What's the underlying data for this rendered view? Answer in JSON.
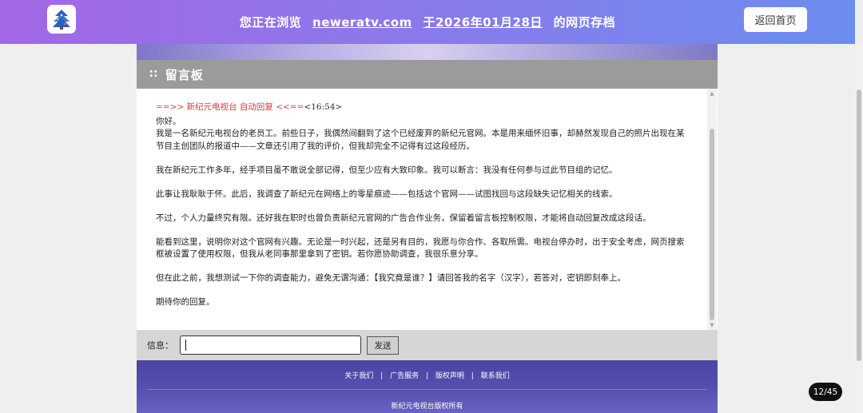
{
  "archive_banner": {
    "prefix": "您正在浏览",
    "domain": "neweratv.com",
    "date_text": "于2026年01月28日",
    "suffix": "的网页存档",
    "home_button": "返回首页"
  },
  "board": {
    "title": "留言板"
  },
  "message": {
    "header": "==>> 新纪元电视台 自动回复 <<==",
    "time": "<16:54>",
    "paragraphs": [
      [
        "你好。",
        "我是一名新纪元电视台的老员工。前些日子，我偶然间翻到了这个已经废弃的新纪元官网。本是用来缅怀旧事，却赫然发现自己的照片出现在某",
        "节目主创团队的报道中——文章还引用了我的评价，但我却完全不记得有过这段经历。"
      ],
      [
        "我在新纪元工作多年，经手项目虽不敢说全部记得，但至少应有大致印象。我可以断言：我没有任何参与过此节目组的记忆。"
      ],
      [
        "此事让我耿耿于怀。此后，我调查了新纪元在网络上的零星痕迹——包括这个官网——试图找回与这段缺失记忆相关的线索。"
      ],
      [
        "不过，个人力量终究有限。还好我在职时也曾负责新纪元官网的广告合作业务，保留着留言板控制权限，才能将自动回复改成这段话。"
      ],
      [
        "能看到这里，说明你对这个官网有兴趣。无论是一时兴起，还是另有目的，我愿与你合作、各取所需。电视台停办时，出于安全考虑，网页搜索",
        "框被设置了使用权限，但我从老同事那里拿到了密钥。若你愿协助调查，我很乐意分享。"
      ],
      [
        "但在此之前，我想测试一下你的调查能力，避免无谓沟通：【我究竟是谁？】请回答我的名字（汉字），若答对，密钥即刻奉上。"
      ],
      [
        "期待你的回复。"
      ]
    ]
  },
  "input": {
    "label": "信息：",
    "value": "",
    "send_label": "发送"
  },
  "footer": {
    "links": [
      "关于我们",
      "广告服务",
      "版权声明",
      "联系我们"
    ],
    "separator": "|",
    "copyright": "新纪元电视台版权所有"
  },
  "page_counter": "12/45",
  "colors": {
    "banner_start": "#a366e6",
    "banner_end": "#6c8df0",
    "title_bar": "#9b9b9b",
    "auto_reply_red": "#d23a3a",
    "footer": "#5750b0"
  }
}
